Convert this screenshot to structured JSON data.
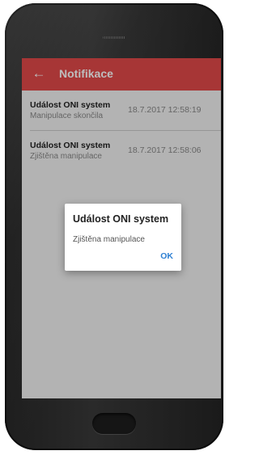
{
  "appbar": {
    "title": "Notifikace",
    "back_icon": "arrow-left-icon",
    "color": "#e24a4a"
  },
  "notifications": [
    {
      "title": "Událost ONI system",
      "subtitle": "Manipulace skončila",
      "time": "18.7.2017 12:58:19"
    },
    {
      "title": "Událost ONI system",
      "subtitle": "Zjištěna manipulace",
      "time": "18.7.2017 12:58:06"
    }
  ],
  "dialog": {
    "title": "Událost ONI system",
    "message": "Zjištěna manipulace",
    "ok_label": "OK",
    "ok_color": "#2d7fd3"
  }
}
